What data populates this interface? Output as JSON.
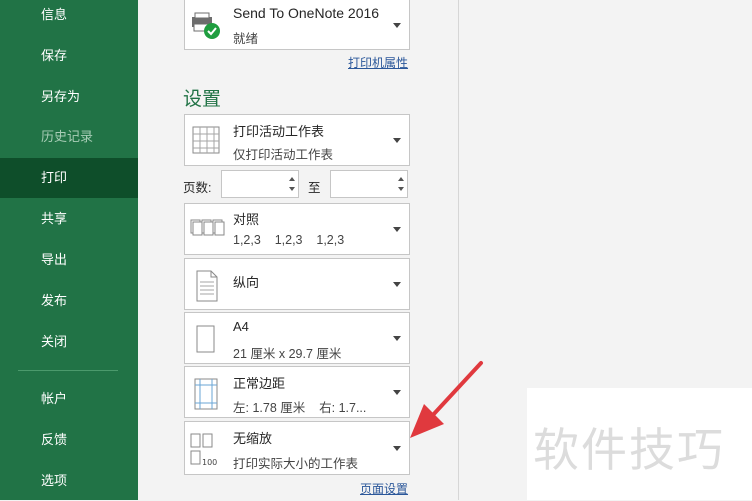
{
  "sidebar": {
    "items": [
      {
        "label": "信息"
      },
      {
        "label": "保存"
      },
      {
        "label": "另存为"
      },
      {
        "label": "历史记录"
      },
      {
        "label": "打印"
      },
      {
        "label": "共享"
      },
      {
        "label": "导出"
      },
      {
        "label": "发布"
      },
      {
        "label": "关闭"
      },
      {
        "label": "帐户"
      },
      {
        "label": "反馈"
      },
      {
        "label": "选项"
      }
    ]
  },
  "printer": {
    "name": "Send To OneNote 2016",
    "status": "就绪",
    "properties_link": "打印机属性"
  },
  "settings": {
    "title": "设置",
    "print_what": {
      "title": "打印活动工作表",
      "subtitle": "仅打印活动工作表"
    },
    "pages_label": "页数:",
    "pages_to_label": "至",
    "pages_from_value": "",
    "pages_to_value": "",
    "collation": {
      "title": "对照",
      "subtitle": "1,2,3    1,2,3    1,2,3"
    },
    "orientation": {
      "title": "纵向"
    },
    "paper": {
      "title": "A4",
      "subtitle": "21 厘米 x 29.7 厘米"
    },
    "margins": {
      "title": "正常边距",
      "subtitle": "左: 1.78 厘米    右: 1.7..."
    },
    "scaling": {
      "title": "无缩放",
      "subtitle": "打印实际大小的工作表"
    },
    "page_setup_link": "页面设置"
  },
  "watermark": "软件技巧",
  "colors": {
    "sidebar": "#217346",
    "active": "#0e4e2a",
    "accent": "#217346",
    "link": "#2b579a",
    "annotation_arrow": "#e0393e"
  }
}
